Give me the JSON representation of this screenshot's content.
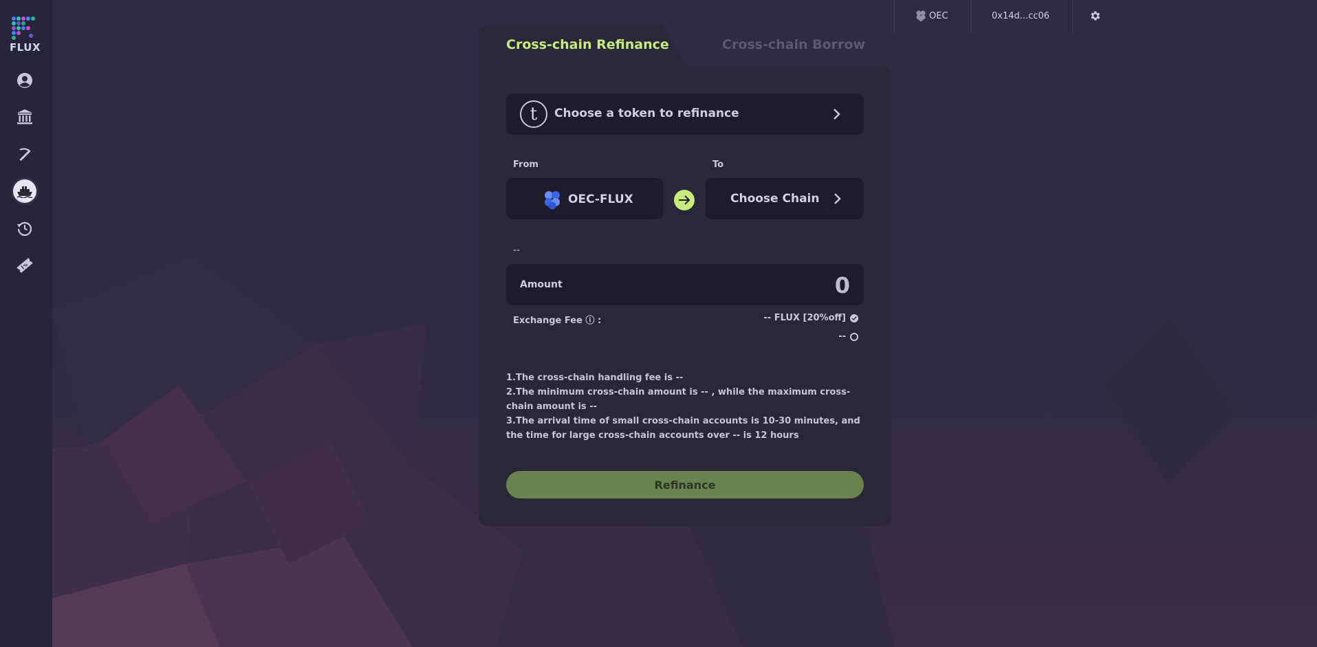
{
  "app": {
    "logo_text": "FLUX"
  },
  "sidebar": {
    "items": [
      {
        "icon": "user-icon",
        "active": false
      },
      {
        "icon": "bank-icon",
        "active": false
      },
      {
        "icon": "pickaxe-icon",
        "active": false
      },
      {
        "icon": "ship-icon",
        "active": true
      },
      {
        "icon": "history-icon",
        "active": false
      },
      {
        "icon": "ticket-icon",
        "active": false
      }
    ]
  },
  "topbar": {
    "network": "OEC",
    "address": "0x14d...cc06",
    "settings_icon": "gear-icon"
  },
  "tabs": {
    "active": "Cross-chain Refinance",
    "inactive": "Cross-chain Borrow"
  },
  "token_select": {
    "placeholder": "Choose a token to refinance",
    "icon_letter": "t"
  },
  "from": {
    "label": "From",
    "chain": "OEC-FLUX"
  },
  "to": {
    "label": "To",
    "chain": "Choose Chain"
  },
  "balance": "--",
  "amount": {
    "label": "Amount",
    "placeholder": "0"
  },
  "fee": {
    "label": "Exchange Fee ⓘ :",
    "option_flux": "-- FLUX [20%off]",
    "option_other": "--"
  },
  "notes": [
    "1.The cross-chain handling fee is --",
    "2.The minimum cross-chain amount is -- , while the maximum cross-chain amount is --",
    "3.The arrival time of small cross-chain accounts is 10-30 minutes, and the time for large cross-chain accounts over -- is 12 hours"
  ],
  "submit_label": "Refinance",
  "colors": {
    "accent_green": "#c5ec7d",
    "button_green": "#6a8150",
    "card": "#2a2838",
    "sidebar": "#27253a"
  }
}
